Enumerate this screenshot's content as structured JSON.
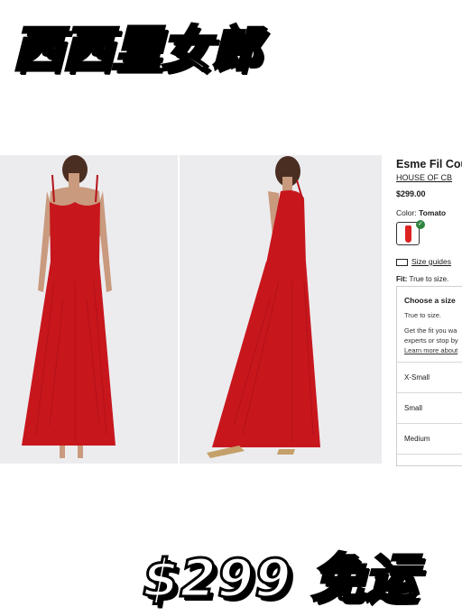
{
  "overlay": {
    "title": "西西里女郎",
    "price_banner": "$299 免运"
  },
  "product": {
    "name": "Esme Fil Coup",
    "brand": "HOUSE OF CB",
    "price": "$299.00",
    "color_label": "Color:",
    "color_value": "Tomato",
    "size_guides": "Size guides",
    "fit_label": "Fit:",
    "fit_value": "True to size."
  },
  "size_selector": {
    "heading": "Choose a size",
    "note": "True to size.",
    "help_line1": "Get the fit you wa",
    "help_line2": "experts or stop by",
    "help_link": "Learn more about",
    "options": [
      "X-Small",
      "Small",
      "Medium"
    ]
  },
  "colors": {
    "dress": "#c8161d",
    "photo_bg": "#ececef",
    "check": "#2e8540"
  }
}
